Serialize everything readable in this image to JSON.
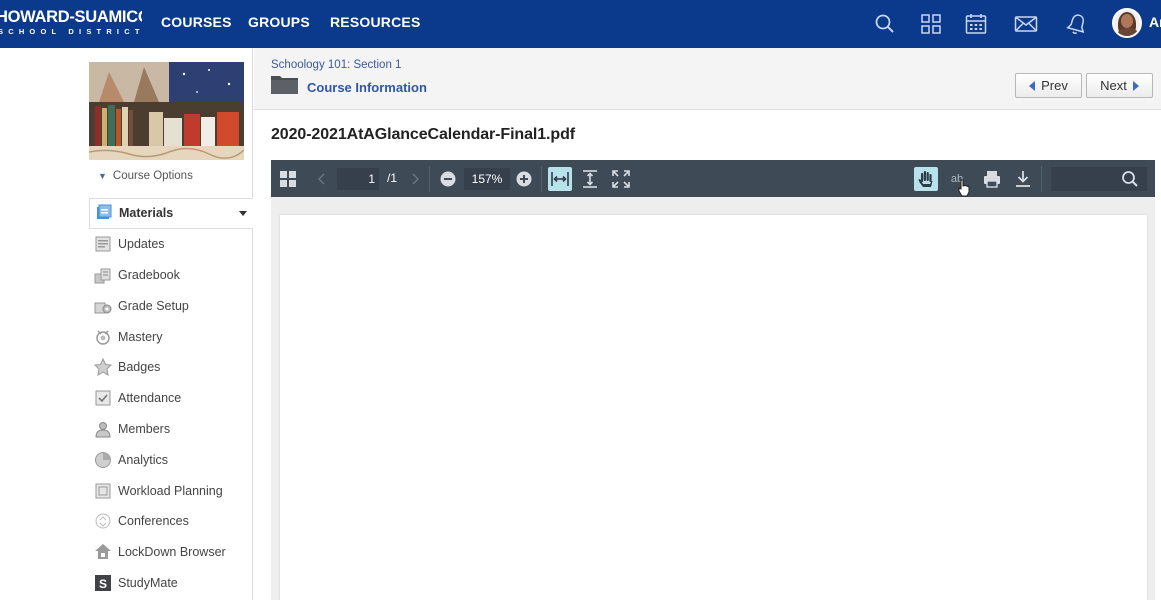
{
  "topbar": {
    "logo_main": "HOWARD-SUAMICO",
    "logo_sub": "SCHOOL DISTRICT",
    "nav": [
      "COURSES",
      "GROUPS",
      "RESOURCES"
    ],
    "user_initials": "Ar",
    "icons": [
      "search-icon",
      "apps-grid-icon",
      "calendar-icon",
      "mail-icon",
      "notifications-bell-icon"
    ],
    "bg_color": "#0b3a8c"
  },
  "sidebar": {
    "course_options": "Course Options",
    "items": [
      {
        "label": "Materials",
        "icon": "materials-icon",
        "active": true
      },
      {
        "label": "Updates",
        "icon": "updates-icon"
      },
      {
        "label": "Gradebook",
        "icon": "gradebook-icon"
      },
      {
        "label": "Grade Setup",
        "icon": "grade-setup-icon"
      },
      {
        "label": "Mastery",
        "icon": "mastery-icon"
      },
      {
        "label": "Badges",
        "icon": "badges-icon"
      },
      {
        "label": "Attendance",
        "icon": "attendance-icon"
      },
      {
        "label": "Members",
        "icon": "members-icon"
      },
      {
        "label": "Analytics",
        "icon": "analytics-icon"
      },
      {
        "label": "Workload Planning",
        "icon": "workload-planning-icon"
      },
      {
        "label": "Conferences",
        "icon": "conferences-icon"
      },
      {
        "label": "LockDown Browser",
        "icon": "lockdown-browser-icon"
      },
      {
        "label": "StudyMate",
        "icon": "studymate-icon"
      }
    ]
  },
  "header": {
    "breadcrumb": "Schoology 101: Section 1",
    "folder_title": "Course Information",
    "prev_label": "Prev",
    "next_label": "Next"
  },
  "document": {
    "file_name": "2020-2021AtAGlanceCalendar-Final1.pdf"
  },
  "pdf_toolbar": {
    "page_current": "1",
    "page_total": "/1",
    "zoom": "157%",
    "annotation_tool_label": "ab"
  }
}
